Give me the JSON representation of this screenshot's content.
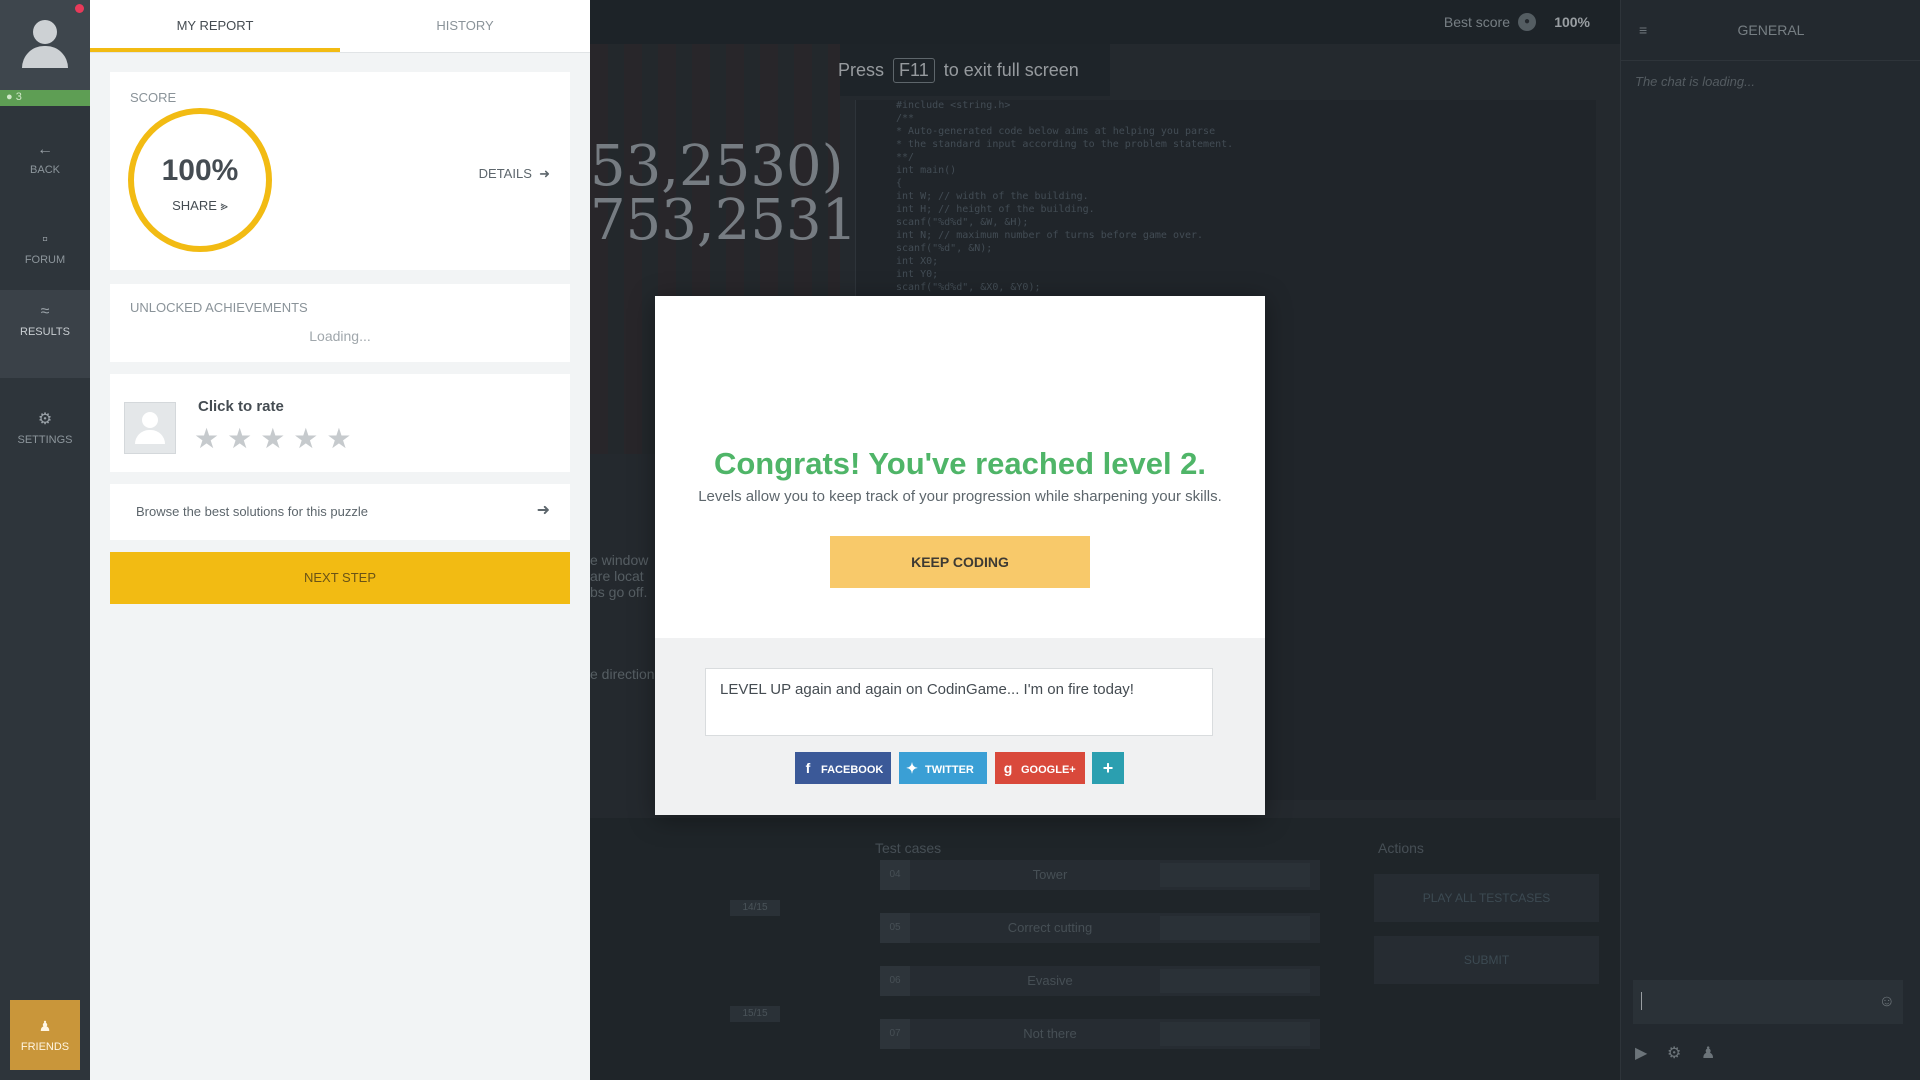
{
  "nav": {
    "level": "3",
    "items": [
      {
        "label": "BACK",
        "icon": "arrow-left-icon"
      },
      {
        "label": "FORUM",
        "icon": "forum-icon"
      },
      {
        "label": "RESULTS",
        "icon": "results-chart-icon"
      },
      {
        "label": "SETTINGS",
        "icon": "gear-icon"
      }
    ],
    "friends_label": "FRIENDS"
  },
  "report": {
    "tabs": [
      "MY REPORT",
      "HISTORY"
    ],
    "score_label": "SCORE",
    "score_value": "100%",
    "share_label": "SHARE",
    "details_label": "DETAILS",
    "achievements_label": "UNLOCKED ACHIEVEMENTS",
    "achievements_loading": "Loading...",
    "rate_label": "Click to rate",
    "stars": "★★★★★",
    "browse_label": "Browse the best solutions for this puzzle",
    "next_step_label": "NEXT STEP"
  },
  "ide": {
    "best_score_label": "Best score",
    "best_score_value": "100%",
    "coords": "53,2530)\n753,2531)",
    "fullscreen_press": "Press",
    "fullscreen_key": "F11",
    "fullscreen_suffix": "to exit full screen",
    "code_lines": [
      "#include <string.h>",
      "/**",
      " * Auto-generated code below aims at helping you parse",
      " * the standard input according to the problem statement.",
      " **/",
      "int main()",
      "{",
      "    int W; // width of the building.",
      "    int H; // height of the building.",
      "    scanf(\"%d%d\", &W, &H);",
      "    int N; // maximum number of turns before game over.",
      "    scanf(\"%d\", &N);",
      "    int X0;",
      "    int Y0;",
      "    scanf(\"%d%d\", &X0, &Y0);"
    ],
    "desc_lines": [
      "e window",
      "are locat",
      "bs go off."
    ],
    "desc_line2": "e direction",
    "testcases_title": "Test cases",
    "actions_title": "Actions",
    "progress": [
      "14/15",
      "15/15"
    ],
    "testcases": [
      {
        "num": "04",
        "name": "Tower"
      },
      {
        "num": "05",
        "name": "Correct cutting"
      },
      {
        "num": "06",
        "name": "Evasive"
      },
      {
        "num": "07",
        "name": "Not there"
      }
    ],
    "play_all_label": "PLAY ALL TESTCASES",
    "submit_label": "SUBMIT"
  },
  "chat": {
    "title": "GENERAL",
    "loading": "The chat is loading..."
  },
  "modal": {
    "title": "Congrats! You've reached level 2.",
    "subtitle": "Levels allow you to keep track of your progression while sharpening your skills.",
    "keep_coding_label": "KEEP CODING",
    "share_text": "LEVEL UP again and again on CodinGame... I'm on fire today!",
    "facebook_label": "FACEBOOK",
    "twitter_label": "TWITTER",
    "google_label": "GOOGLE+",
    "more_label": "+"
  },
  "colors": {
    "accent": "#f2bb13",
    "congrats_green": "#4fb568",
    "facebook": "#3b5998",
    "twitter": "#3a9fd5",
    "google": "#d9493b"
  }
}
